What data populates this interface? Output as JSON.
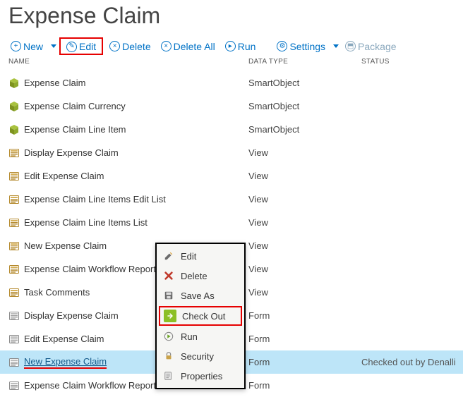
{
  "page_title": "Expense Claim",
  "toolbar": {
    "new": "New",
    "edit": "Edit",
    "delete": "Delete",
    "delete_all": "Delete All",
    "run": "Run",
    "settings": "Settings",
    "package": "Package"
  },
  "columns": {
    "name": "NAME",
    "type": "DATA TYPE",
    "status": "STATUS"
  },
  "rows": [
    {
      "icon": "smartobject",
      "name": "Expense Claim",
      "type": "SmartObject",
      "status": ""
    },
    {
      "icon": "smartobject",
      "name": "Expense Claim Currency",
      "type": "SmartObject",
      "status": ""
    },
    {
      "icon": "smartobject",
      "name": "Expense Claim Line Item",
      "type": "SmartObject",
      "status": ""
    },
    {
      "icon": "view",
      "name": "Display Expense Claim",
      "type": "View",
      "status": ""
    },
    {
      "icon": "view",
      "name": "Edit Expense Claim",
      "type": "View",
      "status": ""
    },
    {
      "icon": "view",
      "name": "Expense Claim Line Items Edit List",
      "type": "View",
      "status": ""
    },
    {
      "icon": "view",
      "name": "Expense Claim Line Items List",
      "type": "View",
      "status": ""
    },
    {
      "icon": "view",
      "name": "New Expense Claim",
      "type": "View",
      "status": ""
    },
    {
      "icon": "view",
      "name": "Expense Claim Workflow Reports",
      "type": "View",
      "status": ""
    },
    {
      "icon": "view",
      "name": "Task Comments",
      "type": "View",
      "status": ""
    },
    {
      "icon": "form",
      "name": "Display Expense Claim",
      "type": "Form",
      "status": ""
    },
    {
      "icon": "form",
      "name": "Edit Expense Claim",
      "type": "Form",
      "status": ""
    },
    {
      "icon": "form",
      "name": "New Expense Claim",
      "type": "Form",
      "status": "Checked out by Denallix",
      "selected": true,
      "underlined": true
    },
    {
      "icon": "form",
      "name": "Expense Claim Workflow Reports",
      "type": "Form",
      "status": ""
    }
  ],
  "context_menu": {
    "edit": "Edit",
    "delete": "Delete",
    "save_as": "Save As",
    "check_out": "Check Out",
    "run": "Run",
    "security": "Security",
    "properties": "Properties"
  }
}
